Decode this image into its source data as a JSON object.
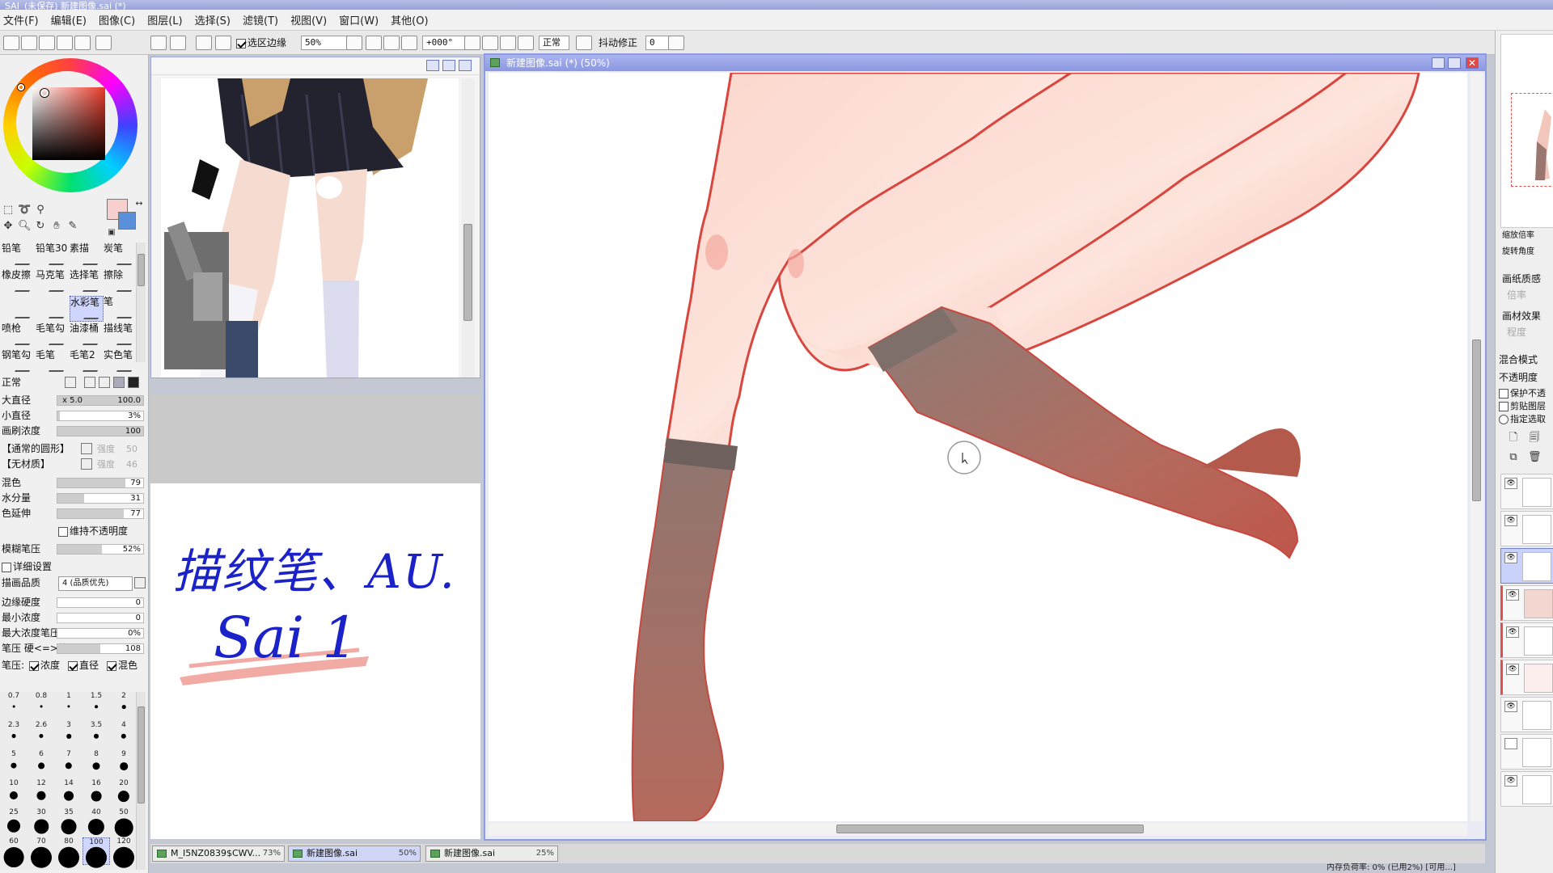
{
  "window": {
    "title": "(未保存) 新建图像.sai (*)",
    "app_logo": "SAI"
  },
  "menu": [
    "文件(F)",
    "编辑(E)",
    "图像(C)",
    "图层(L)",
    "选择(S)",
    "滤镜(T)",
    "视图(V)",
    "窗口(W)",
    "其他(O)"
  ],
  "toolbar": {
    "selection_edge_label": "选区边缘",
    "zoom_value": "50%",
    "rotation_value": "+000°",
    "blend_mode": "正常",
    "stabilizer_label": "抖动修正",
    "stabilizer_value": "0"
  },
  "left_panel": {
    "brushes": [
      {
        "label": "铅笔",
        "selected": false
      },
      {
        "label": "铅笔30",
        "selected": false
      },
      {
        "label": "素描",
        "selected": false
      },
      {
        "label": "炭笔",
        "selected": false
      },
      {
        "label": "橡皮擦",
        "selected": false
      },
      {
        "label": "马克笔",
        "selected": false
      },
      {
        "label": "选择笔",
        "selected": false
      },
      {
        "label": "擦除",
        "selected": false
      },
      {
        "label": "",
        "selected": false
      },
      {
        "label": "",
        "selected": false
      },
      {
        "label": "水彩笔",
        "selected": true
      },
      {
        "label": "笔",
        "selected": false
      },
      {
        "label": "喷枪",
        "selected": false
      },
      {
        "label": "毛笔勾",
        "selected": false
      },
      {
        "label": "油漆桶",
        "selected": false
      },
      {
        "label": "描线笔",
        "selected": false
      },
      {
        "label": "钢笔勾",
        "selected": false
      },
      {
        "label": "毛笔",
        "selected": false
      },
      {
        "label": "毛笔2",
        "selected": false
      },
      {
        "label": "实色笔",
        "selected": false
      }
    ],
    "mode_label": "正常",
    "params": {
      "max_size_label": "大直径",
      "max_size_mult": "x 5.0",
      "max_size_value": "100.0",
      "min_size_label": "小直径",
      "min_size_value": "3%",
      "density_label": "画刷浓度",
      "density_value": "100",
      "shape_label": "【通常的圆形】",
      "shape_strength": "强度",
      "shape_strength_value": "50",
      "texture_label": "【无材质】",
      "texture_strength": "强度",
      "texture_strength_value": "46",
      "blending_label": "混色",
      "blending_value": "79",
      "dilution_label": "水分量",
      "dilution_value": "31",
      "persistence_label": "色延伸",
      "persistence_value": "77",
      "keep_opacity_label": "维持不透明度",
      "blur_pressure_label": "模糊笔压",
      "blur_pressure_value": "52%",
      "advanced_label": "详细设置",
      "quality_label": "描画品质",
      "quality_value": "4 (品质优先)",
      "edge_hardness_label": "边缘硬度",
      "edge_hardness_value": "0",
      "min_density_label": "最小浓度",
      "min_density_value": "0",
      "max_density_pressure_label": "最大浓度笔压",
      "max_density_pressure_value": "0%",
      "pressure_label": "笔压 硬<=>软",
      "pressure_value": "108",
      "pressure_opts_label": "笔压:",
      "pressure_opt_density": "浓度",
      "pressure_opt_size": "直径",
      "pressure_opt_blend": "混色"
    },
    "brush_sizes": [
      "0.7",
      "0.8",
      "1",
      "1.5",
      "2",
      "2.3",
      "2.6",
      "3",
      "3.5",
      "4",
      "5",
      "6",
      "7",
      "8",
      "9",
      "10",
      "12",
      "14",
      "16",
      "20",
      "25",
      "30",
      "35",
      "40",
      "50",
      "60",
      "70",
      "80",
      "100",
      "120"
    ]
  },
  "notes": {
    "line1": "描纹笔、AU.",
    "line2": "Sai 1"
  },
  "canvas_window": {
    "title": "新建图像.sai (*) (50%)"
  },
  "tabs": [
    {
      "name": "M_I5NZ0839$CWV...",
      "pct": "73%"
    },
    {
      "name": "新建图像.sai",
      "pct": "50%"
    },
    {
      "name": "新建图像.sai",
      "pct": "25%"
    }
  ],
  "right_panel": {
    "zoom_label": "缩放倍率",
    "rotate_label": "旋转角度",
    "paper_texture_label": "画纸质感",
    "paper_texture_sub": "倍率",
    "paper_effect_label": "画材效果",
    "paper_effect_sub": "程度",
    "blend_mode_label": "混合模式",
    "opacity_label": "不透明度",
    "protect_label": "保护不透",
    "clip_label": "剪贴图层",
    "select_label": "指定选取"
  },
  "status": {
    "text": "内存负荷率: 0% (已用2%) [可用...]"
  },
  "colors": {
    "primary": "#f7cfcf",
    "secondary": "#5a8fdc",
    "accent": "#8f9be0"
  }
}
